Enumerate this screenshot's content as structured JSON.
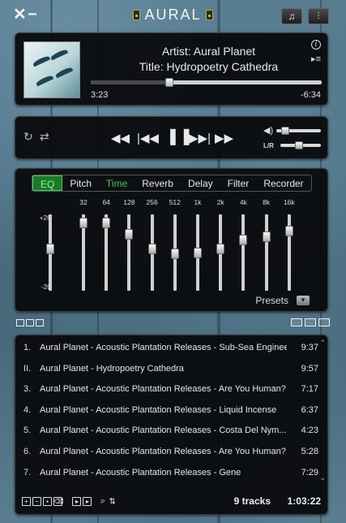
{
  "window": {
    "title": "AURAL",
    "close_icon": "close-icon",
    "minimize_icon": "minimize-icon"
  },
  "now_playing": {
    "artist_label": "Artist:  Aural Planet",
    "title_label": "Title:  Hydropoetry Cathedra",
    "elapsed": "3:23",
    "remaining": "-6:34",
    "progress": 0.34
  },
  "controls": {
    "lr_label": "L/R",
    "volume": 0.1,
    "balance": 0.45
  },
  "effects": {
    "tabs": [
      {
        "label": "EQ"
      },
      {
        "label": "Pitch"
      },
      {
        "label": "Time"
      },
      {
        "label": "Reverb"
      },
      {
        "label": "Delay"
      },
      {
        "label": "Filter"
      },
      {
        "label": "Recorder"
      }
    ],
    "active_tab": "EQ",
    "db_labels": [
      "+20",
      "0",
      "-20"
    ],
    "bands": [
      {
        "freq": "32",
        "level": 0.95
      },
      {
        "freq": "64",
        "level": 0.95
      },
      {
        "freq": "128",
        "level": 0.78
      },
      {
        "freq": "256",
        "level": 0.55
      },
      {
        "freq": "512",
        "level": 0.48
      },
      {
        "freq": "1k",
        "level": 0.5
      },
      {
        "freq": "2k",
        "level": 0.55
      },
      {
        "freq": "4k",
        "level": 0.69
      },
      {
        "freq": "8k",
        "level": 0.74
      },
      {
        "freq": "16k",
        "level": 0.83
      }
    ],
    "preamp_level": 0.55,
    "presets_label": "Presets"
  },
  "playlist": {
    "tracks": [
      {
        "index": "1.",
        "name": "Aural Planet - Acoustic Plantation Releases - Sub-Sea Enginee...",
        "duration": "9:37"
      },
      {
        "index": "II.",
        "name": "Aural Planet - Hydropoetry Cathedra",
        "duration": "9:57"
      },
      {
        "index": "3.",
        "name": "Aural Planet - Acoustic Plantation Releases - Are You Human?",
        "duration": "7:17"
      },
      {
        "index": "4.",
        "name": "Aural Planet - Acoustic Plantation Releases - Liquid Incense",
        "duration": "6:37"
      },
      {
        "index": "5.",
        "name": "Aural Planet - Acoustic Plantation Releases - Costa Del Nym...",
        "duration": "4:23"
      },
      {
        "index": "6.",
        "name": "Aural Planet - Acoustic Plantation Releases - Are You Human?...",
        "duration": "5:28"
      },
      {
        "index": "7.",
        "name": "Aural Planet - Acoustic Plantation Releases - Gene",
        "duration": "7:29"
      }
    ],
    "track_count": "9 tracks",
    "total_duration": "1:03:22"
  },
  "colors": {
    "accent_green": "#3ecb52",
    "panel_bg": "#08080a"
  }
}
